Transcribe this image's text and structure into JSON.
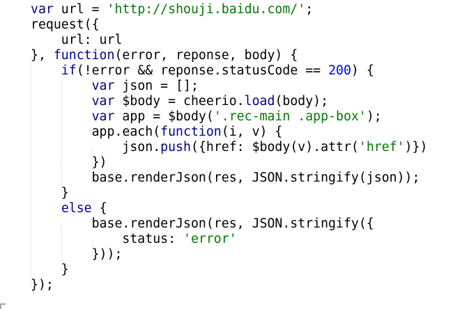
{
  "editor": {
    "colors": {
      "background": "#ffffff",
      "plain": "#000000",
      "keyword": "#00008b",
      "string": "#007a00",
      "number": "#0000ff",
      "method": "#000080"
    },
    "lines": [
      [
        [
          "var",
          "kw"
        ],
        [
          " url = ",
          "plain"
        ],
        [
          "'http://shouji.baidu.com/'",
          "str"
        ],
        [
          ";",
          "plain"
        ]
      ],
      [
        [
          "request({",
          "plain"
        ]
      ],
      [
        [
          "    url: url",
          "plain"
        ]
      ],
      [
        [
          "}, ",
          "plain"
        ],
        [
          "function",
          "kw"
        ],
        [
          "(error, reponse, body) {",
          "plain"
        ]
      ],
      [
        [
          "    ",
          "plain"
        ],
        [
          "if",
          "kw"
        ],
        [
          "(!error && reponse.statusCode == ",
          "plain"
        ],
        [
          "200",
          "num"
        ],
        [
          ") {",
          "plain"
        ]
      ],
      [
        [
          "        ",
          "plain"
        ],
        [
          "var",
          "kw"
        ],
        [
          " json = [];",
          "plain"
        ]
      ],
      [
        [
          "        ",
          "plain"
        ],
        [
          "var",
          "kw"
        ],
        [
          " $body = cheerio.",
          "plain"
        ],
        [
          "load",
          "fn"
        ],
        [
          "(body);",
          "plain"
        ]
      ],
      [
        [
          "        ",
          "plain"
        ],
        [
          "var",
          "kw"
        ],
        [
          " app = $body(",
          "plain"
        ],
        [
          "'.rec-main .app-box'",
          "str"
        ],
        [
          ");",
          "plain"
        ]
      ],
      [
        [
          "        app.each(",
          "plain"
        ],
        [
          "function",
          "kw"
        ],
        [
          "(i, v) {",
          "plain"
        ]
      ],
      [
        [
          "            json.",
          "plain"
        ],
        [
          "push",
          "fn"
        ],
        [
          "({href: $body(v).attr(",
          "plain"
        ],
        [
          "'href'",
          "str"
        ],
        [
          ")})",
          "plain"
        ]
      ],
      [
        [
          "        })",
          "plain"
        ]
      ],
      [
        [
          "        base.renderJson(res, JSON.stringify(json));",
          "plain"
        ]
      ],
      [
        [
          "    }",
          "plain"
        ]
      ],
      [
        [
          "    ",
          "plain"
        ],
        [
          "else",
          "kw"
        ],
        [
          " {",
          "plain"
        ]
      ],
      [
        [
          "        base.renderJson(res, JSON.stringify({",
          "plain"
        ]
      ],
      [
        [
          "            status: ",
          "plain"
        ],
        [
          "'error'",
          "str"
        ]
      ],
      [
        [
          "        }));",
          "plain"
        ]
      ],
      [
        [
          "    }",
          "plain"
        ]
      ],
      [
        [
          "});",
          "plain"
        ]
      ]
    ]
  }
}
